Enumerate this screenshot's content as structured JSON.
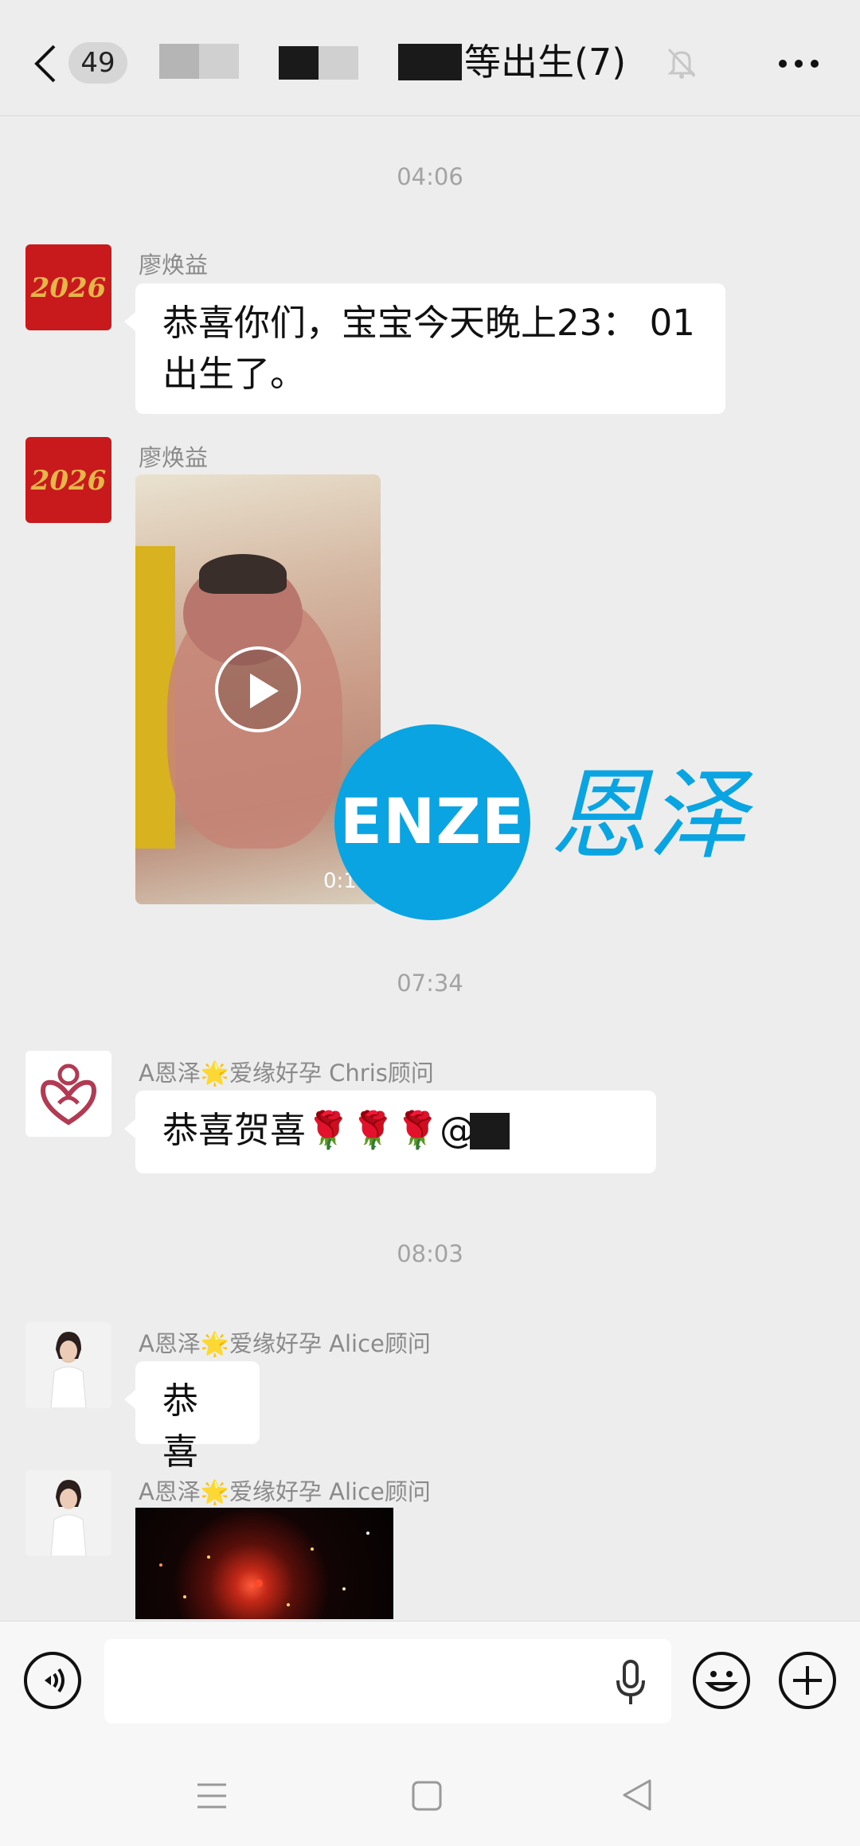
{
  "header": {
    "back_icon": "chevron-left-icon",
    "unread_count": "49",
    "title": "等出生(7)",
    "mute_icon": "bell-off-icon",
    "more_icon": "more-dots-icon"
  },
  "messages": [
    {
      "type": "time",
      "text": "04:06"
    },
    {
      "type": "text",
      "sender": "廖焕益",
      "avatar": "2026-red-avatar",
      "lines": [
        "恭喜你们，宝宝今天晚上23： 01",
        "出生了。"
      ]
    },
    {
      "type": "video",
      "sender": "廖焕益",
      "avatar": "2026-red-avatar",
      "duration": "0:1"
    },
    {
      "type": "time",
      "text": "07:34"
    },
    {
      "type": "text",
      "sender": "A恩泽🌟爱缘好孕 Chris顾问",
      "avatar": "enze-logo-avatar",
      "text": "恭喜贺喜🌹🌹🌹@"
    },
    {
      "type": "time",
      "text": "08:03"
    },
    {
      "type": "text",
      "sender": "A恩泽🌟爱缘好孕 Alice顾问",
      "avatar": "woman-photo-avatar",
      "text": "恭喜"
    },
    {
      "type": "image",
      "sender": "A恩泽🌟爱缘好孕 Alice顾问",
      "avatar": "woman-photo-avatar"
    }
  ],
  "avatar_text": "2026",
  "watermark": {
    "brand": "ENZE",
    "chinese": "恩泽",
    "color": "#0aa4e2"
  },
  "input_bar": {
    "voice_icon": "voice-mode-icon",
    "mic_icon": "microphone-icon",
    "emoji_icon": "emoji-icon",
    "plus_icon": "plus-icon"
  },
  "nav_bar": {
    "menu_icon": "menu-icon",
    "home_icon": "home-square-icon",
    "back_icon": "back-triangle-icon"
  },
  "colors": {
    "background": "#ededed",
    "bubble": "#ffffff",
    "sender_text": "#8a8a8a",
    "time_text": "#a3a3a3"
  }
}
